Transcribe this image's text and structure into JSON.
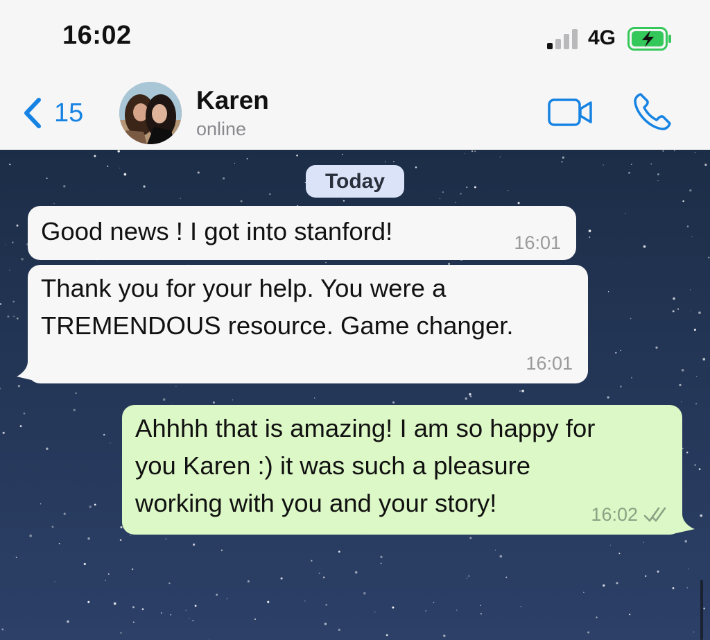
{
  "status_bar": {
    "time": "16:02",
    "network": "4G",
    "battery_state": "charging",
    "battery_color": "#34c759",
    "signal_icon": "signal-bars-icon"
  },
  "header": {
    "back_count": "15",
    "contact_name": "Karen",
    "contact_status": "online",
    "accent_color": "#1683e3",
    "icons": [
      "chevron-left-icon",
      "video-call-icon",
      "phone-icon"
    ]
  },
  "chat": {
    "day_separator": "Today",
    "messages": [
      {
        "direction": "incoming",
        "text": "Good news ! I got into stanford!",
        "time": "16:01"
      },
      {
        "direction": "incoming",
        "text": "Thank you for your help. You were a\nTREMENDOUS resource. Game changer.",
        "time": "16:01"
      },
      {
        "direction": "outgoing",
        "text": "Ahhhh that is amazing! I am so happy for\nyou Karen :) it was such a pleasure\nworking with you and your story!",
        "time": "16:02",
        "status": "delivered"
      }
    ],
    "incoming_bubble_color": "#f7f7f7",
    "outgoing_bubble_color": "#dcf8c6"
  }
}
